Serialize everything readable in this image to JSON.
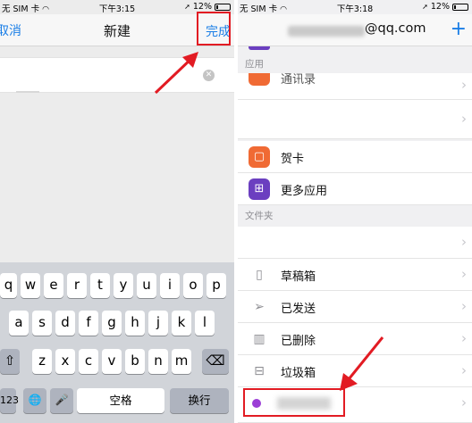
{
  "left": {
    "status": {
      "carrier": "无 SIM 卡",
      "time": "下午3:15",
      "battery": "12%"
    },
    "nav": {
      "cancel": "取消",
      "title": "新建",
      "done": "完成"
    },
    "keyboard": {
      "row1": [
        "q",
        "w",
        "e",
        "r",
        "t",
        "y",
        "u",
        "i",
        "o",
        "p"
      ],
      "row2": [
        "a",
        "s",
        "d",
        "f",
        "g",
        "h",
        "j",
        "k",
        "l"
      ],
      "row3": [
        "z",
        "x",
        "c",
        "v",
        "b",
        "n",
        "m"
      ],
      "shift": "⇧",
      "delete": "⌫",
      "numbers": "123",
      "globe": "🌐",
      "mic": "🎤",
      "space": "空格",
      "return": "换行"
    }
  },
  "right": {
    "status": {
      "carrier": "无 SIM 卡",
      "time": "下午3:18",
      "battery": "12%"
    },
    "nav": {
      "email_domain": "@qq.com",
      "add": "+"
    },
    "section_apps": "应用",
    "apps": [
      {
        "label": "通讯录"
      },
      {
        "label": ""
      },
      {
        "label": "贺卡"
      },
      {
        "label": "更多应用"
      }
    ],
    "section_folders": "文件夹",
    "folders": [
      {
        "label": ""
      },
      {
        "label": "草稿箱"
      },
      {
        "label": "已发送"
      },
      {
        "label": "已删除"
      },
      {
        "label": "垃圾箱"
      }
    ],
    "colors": {
      "accent": "#1a7ee6",
      "highlight": "#e21b23"
    },
    "icons": {
      "greeting_card": "card-icon",
      "more_apps": "grid-icon",
      "drafts": "document-icon",
      "sent": "paper-plane-icon",
      "deleted": "trash-icon",
      "junk": "archive-box-icon"
    }
  }
}
